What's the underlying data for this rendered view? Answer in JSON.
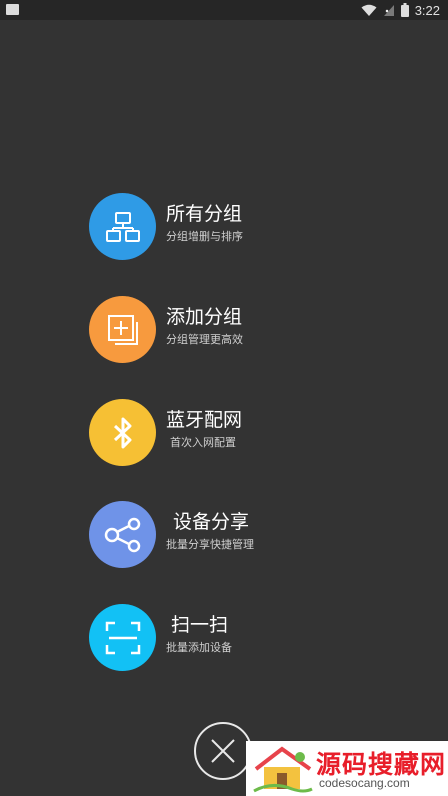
{
  "status_bar": {
    "time": "3:22"
  },
  "menu": {
    "items": [
      {
        "title": "所有分组",
        "subtitle": "分组增删与排序",
        "color": "#2f9be6",
        "icon": "group-tree-icon"
      },
      {
        "title": "添加分组",
        "subtitle": "分组管理更高效",
        "color": "#f79a3e",
        "icon": "add-group-icon"
      },
      {
        "title": "蓝牙配网",
        "subtitle": "首次入网配置",
        "color": "#f6c034",
        "icon": "bluetooth-icon"
      },
      {
        "title": "设备分享",
        "subtitle": "批量分享快捷管理",
        "color": "#6f93e8",
        "icon": "share-icon"
      },
      {
        "title": "扫一扫",
        "subtitle": "批量添加设备",
        "color": "#12c1f5",
        "icon": "scan-icon"
      }
    ]
  },
  "close_button": {
    "icon": "close-icon"
  },
  "watermark": {
    "title": "源码搜藏网",
    "url": "codesocang.com"
  }
}
